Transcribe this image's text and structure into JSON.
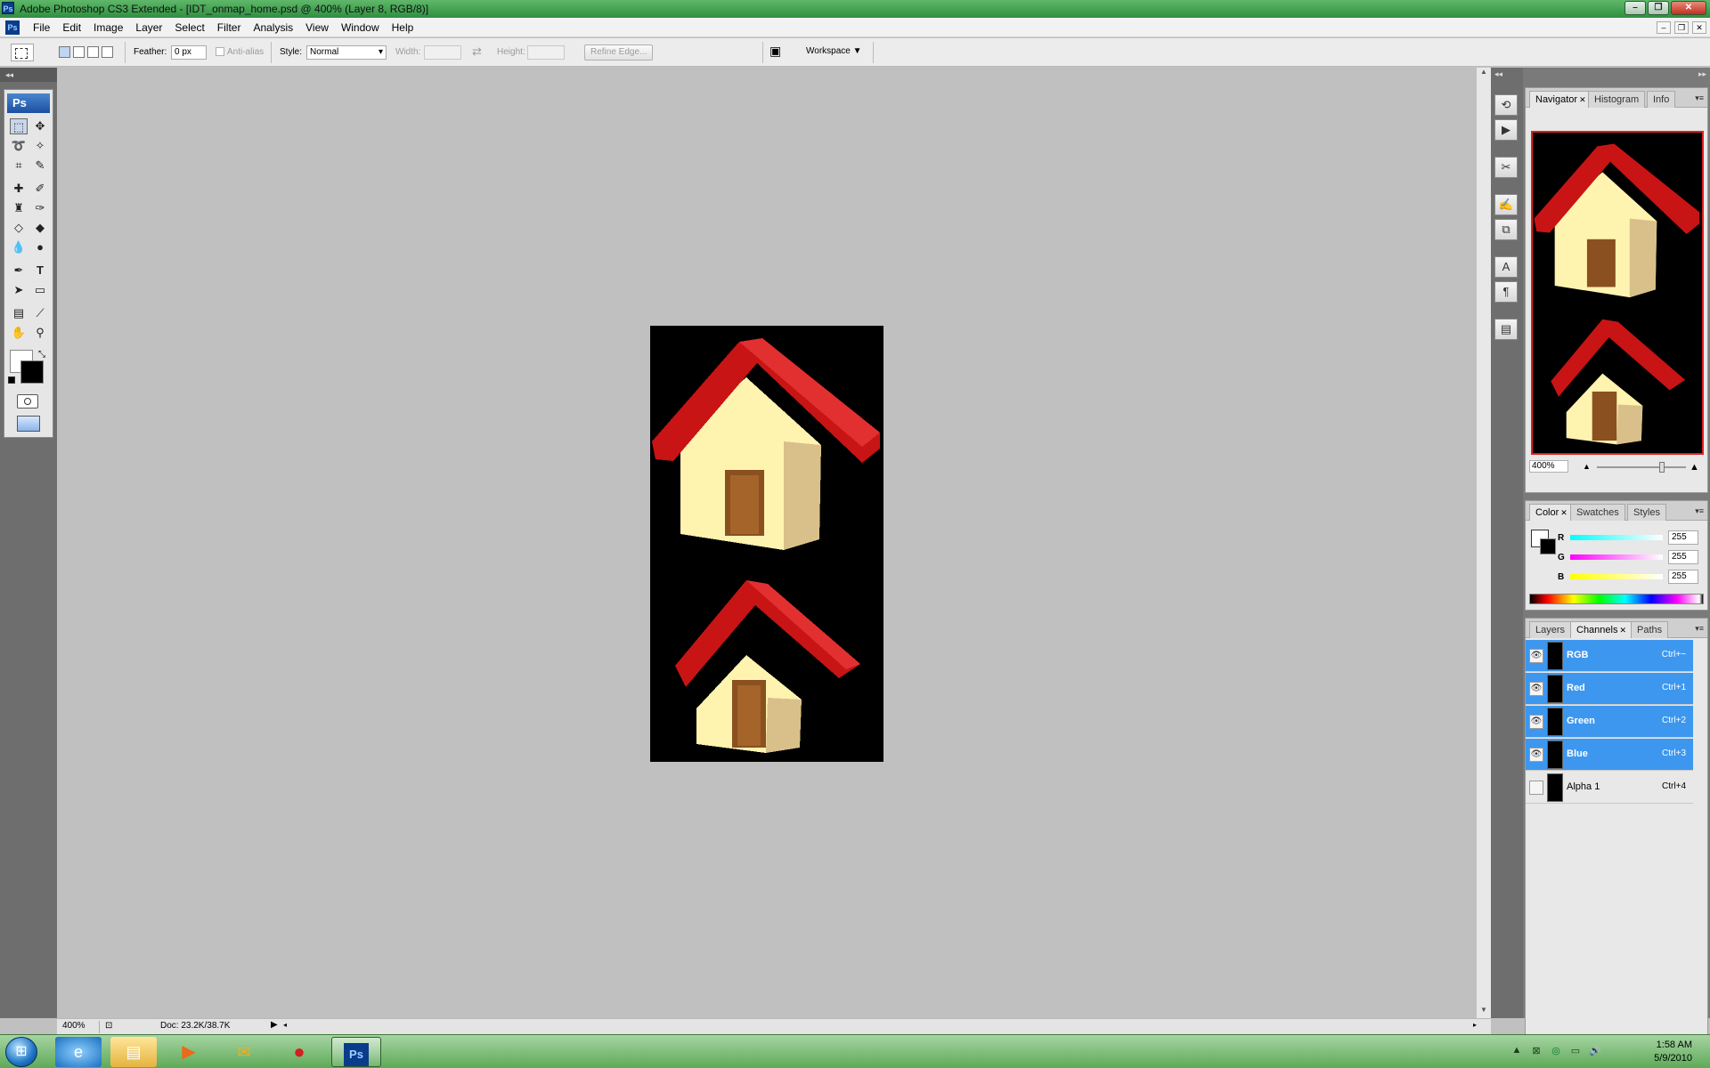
{
  "window": {
    "title": "Adobe Photoshop CS3 Extended - [IDT_onmap_home.psd @ 400% (Layer 8, RGB/8)]",
    "app_icon": "Ps"
  },
  "menu": [
    "File",
    "Edit",
    "Image",
    "Layer",
    "Select",
    "Filter",
    "Analysis",
    "View",
    "Window",
    "Help"
  ],
  "options_bar": {
    "feather_label": "Feather:",
    "feather_value": "0 px",
    "antialias_label": "Anti-alias",
    "style_label": "Style:",
    "style_value": "Normal",
    "width_label": "Width:",
    "height_label": "Height:",
    "refine_edge": "Refine Edge...",
    "workspace": "Workspace ▼"
  },
  "toolbox": {
    "logo": "Ps"
  },
  "status": {
    "zoom": "400%",
    "doc": "Doc: 23.2K/38.7K"
  },
  "navigator": {
    "tabs": [
      "Navigator",
      "Histogram",
      "Info"
    ],
    "zoom": "400%"
  },
  "color_panel": {
    "tabs": [
      "Color",
      "Swatches",
      "Styles"
    ],
    "channels": [
      {
        "label": "R",
        "value": "255",
        "gradient": "linear-gradient(90deg,#0ff,#fff)"
      },
      {
        "label": "G",
        "value": "255",
        "gradient": "linear-gradient(90deg,#f0f,#fff)"
      },
      {
        "label": "B",
        "value": "255",
        "gradient": "linear-gradient(90deg,#ff0,#fff)"
      }
    ]
  },
  "channels_panel": {
    "tabs": [
      "Layers",
      "Channels",
      "Paths"
    ],
    "rows": [
      {
        "name": "RGB",
        "shortcut": "Ctrl+~",
        "selected": true,
        "visible": true
      },
      {
        "name": "Red",
        "shortcut": "Ctrl+1",
        "selected": true,
        "visible": true
      },
      {
        "name": "Green",
        "shortcut": "Ctrl+2",
        "selected": true,
        "visible": true
      },
      {
        "name": "Blue",
        "shortcut": "Ctrl+3",
        "selected": true,
        "visible": true
      },
      {
        "name": "Alpha 1",
        "shortcut": "Ctrl+4",
        "selected": false,
        "visible": false
      }
    ]
  },
  "taskbar": {
    "clock_time": "1:58 AM",
    "clock_date": "5/9/2010",
    "items": [
      "ie-icon",
      "explorer-icon",
      "media-player-icon",
      "messenger-icon",
      "media-app-icon",
      "photoshop-icon"
    ]
  },
  "colors": {
    "selection_blue": "#3d97ef",
    "roof_red": "#c81414",
    "wall_cream": "#fff7c0"
  }
}
